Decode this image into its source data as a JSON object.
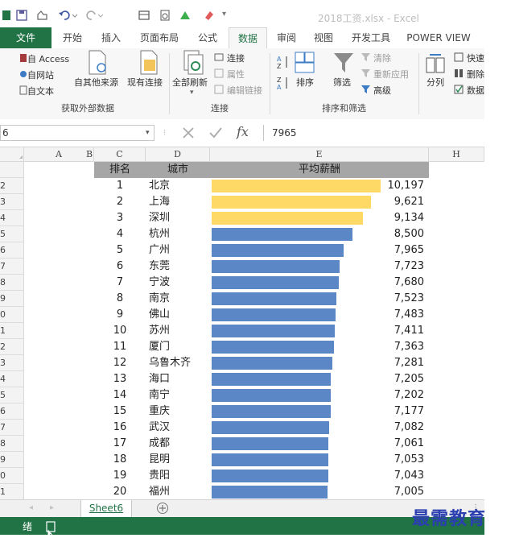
{
  "window": {
    "title": "2018工资.xlsx - Excel"
  },
  "tabs": [
    "文件",
    "开始",
    "插入",
    "页面布局",
    "公式",
    "数据",
    "审阅",
    "视图",
    "开发工具",
    "POWER VIEW"
  ],
  "active_tab": "数据",
  "ribbon": {
    "external_data": {
      "access": "自 Access",
      "web": "自网站",
      "text": "自文本",
      "other_sources": "自其他来源",
      "existing_connections": "现有连接",
      "group_label": "获取外部数据"
    },
    "connections": {
      "refresh_all": "全部刷新",
      "connections": "连接",
      "properties": "属性",
      "edit_links": "编辑链接",
      "group_label": "连接"
    },
    "sort_filter": {
      "sort": "排序",
      "filter": "筛选",
      "clear": "清除",
      "reapply": "重新应用",
      "advanced": "高级",
      "group_label": "排序和筛选"
    },
    "data_tools": {
      "split": "分列",
      "quick": "快速",
      "delete": "删除",
      "data": "数据"
    }
  },
  "formula_bar": {
    "name_box": "6",
    "fx": "fx",
    "value": "7965"
  },
  "columns": [
    "A",
    "B",
    "C",
    "D",
    "E",
    "H"
  ],
  "row_numbers": [
    "",
    "2",
    "3",
    "4",
    "5",
    "6",
    "7",
    "8",
    "9",
    "0",
    "1",
    "2",
    "3",
    "4",
    "5",
    "6",
    "7",
    "8",
    "9",
    "0",
    "1"
  ],
  "table": {
    "headers": {
      "rank": "排名",
      "city": "城市",
      "salary": "平均薪酬"
    },
    "rows": [
      {
        "rank": "1",
        "city": "北京",
        "salary_text": "10,197",
        "salary": 10197,
        "highlight": true
      },
      {
        "rank": "2",
        "city": "上海",
        "salary_text": "9,621",
        "salary": 9621,
        "highlight": true
      },
      {
        "rank": "3",
        "city": "深圳",
        "salary_text": "9,134",
        "salary": 9134,
        "highlight": true
      },
      {
        "rank": "4",
        "city": "杭州",
        "salary_text": "8,500",
        "salary": 8500,
        "highlight": false
      },
      {
        "rank": "5",
        "city": "广州",
        "salary_text": "7,965",
        "salary": 7965,
        "highlight": false
      },
      {
        "rank": "6",
        "city": "东莞",
        "salary_text": "7,723",
        "salary": 7723,
        "highlight": false
      },
      {
        "rank": "7",
        "city": "宁波",
        "salary_text": "7,680",
        "salary": 7680,
        "highlight": false
      },
      {
        "rank": "8",
        "city": "南京",
        "salary_text": "7,523",
        "salary": 7523,
        "highlight": false
      },
      {
        "rank": "9",
        "city": "佛山",
        "salary_text": "7,483",
        "salary": 7483,
        "highlight": false
      },
      {
        "rank": "10",
        "city": "苏州",
        "salary_text": "7,411",
        "salary": 7411,
        "highlight": false
      },
      {
        "rank": "11",
        "city": "厦门",
        "salary_text": "7,363",
        "salary": 7363,
        "highlight": false
      },
      {
        "rank": "12",
        "city": "乌鲁木齐",
        "salary_text": "7,281",
        "salary": 7281,
        "highlight": false
      },
      {
        "rank": "13",
        "city": "海口",
        "salary_text": "7,205",
        "salary": 7205,
        "highlight": false
      },
      {
        "rank": "14",
        "city": "南宁",
        "salary_text": "7,202",
        "salary": 7202,
        "highlight": false
      },
      {
        "rank": "15",
        "city": "重庆",
        "salary_text": "7,177",
        "salary": 7177,
        "highlight": false
      },
      {
        "rank": "16",
        "city": "武汉",
        "salary_text": "7,082",
        "salary": 7082,
        "highlight": false
      },
      {
        "rank": "17",
        "city": "成都",
        "salary_text": "7,061",
        "salary": 7061,
        "highlight": false
      },
      {
        "rank": "18",
        "city": "昆明",
        "salary_text": "7,053",
        "salary": 7053,
        "highlight": false
      },
      {
        "rank": "19",
        "city": "贵阳",
        "salary_text": "7,043",
        "salary": 7043,
        "highlight": false
      },
      {
        "rank": "20",
        "city": "福州",
        "salary_text": "7,005",
        "salary": 7005,
        "highlight": false
      }
    ]
  },
  "colors": {
    "bar_highlight": "#ffd966",
    "bar_normal": "#5b87c7",
    "header_fill": "#a6a6a6",
    "excel_green": "#217346"
  },
  "sheet_tab": "Sheet6",
  "status_text": "绪",
  "watermark": "最需教育"
}
